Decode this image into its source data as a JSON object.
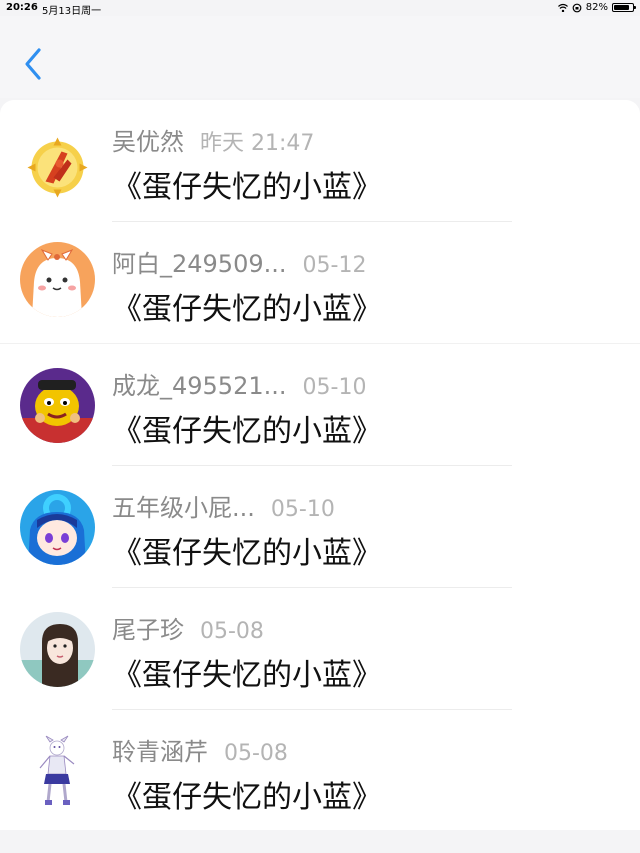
{
  "status": {
    "time": "20:26",
    "date": "5月13日周一",
    "battery": "82%",
    "battery_level": 0.82
  },
  "nav": {
    "back_icon": "chevron-left-icon"
  },
  "items": [
    {
      "name": "吴优然",
      "time": "昨天 21:47",
      "message": "《蛋仔失忆的小蓝》"
    },
    {
      "name": "阿白_249509...",
      "time": "05-12",
      "message": "《蛋仔失忆的小蓝》"
    },
    {
      "name": "成龙_495521...",
      "time": "05-10",
      "message": "《蛋仔失忆的小蓝》"
    },
    {
      "name": "五年级小屁...",
      "time": "05-10",
      "message": "《蛋仔失忆的小蓝》"
    },
    {
      "name": "尾子珍",
      "time": "05-08",
      "message": "《蛋仔失忆的小蓝》"
    },
    {
      "name": "聆青涵芹",
      "time": "05-08",
      "message": "《蛋仔失忆的小蓝》"
    }
  ],
  "colors": {
    "accent": "#2f8ff0",
    "name_gray": "#8a8a8a",
    "time_gray": "#b4b4b4"
  }
}
